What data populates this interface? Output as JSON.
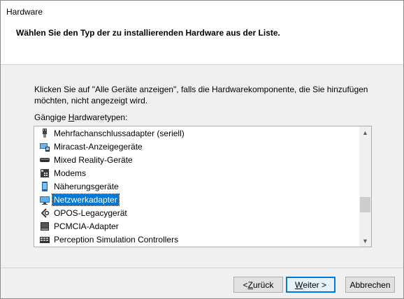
{
  "window": {
    "title": "Hardware",
    "subtitle": "Wählen Sie den Typ der zu installierenden Hardware aus der Liste."
  },
  "description": "Klicken Sie auf \"Alle Geräte anzeigen\", falls die Hardwarekomponente, die Sie hinzufügen möchten, nicht angezeigt wird.",
  "list": {
    "label_prefix": "Gängige ",
    "label_mnemonic": "H",
    "label_rest": "ardwaretypen:",
    "items": [
      {
        "label": "Mehrfachanschlussadapter (seriell)",
        "icon": "serial-port-icon"
      },
      {
        "label": "Miracast-Anzeigegeräte",
        "icon": "miracast-display-icon"
      },
      {
        "label": "Mixed Reality-Geräte",
        "icon": "headset-icon"
      },
      {
        "label": "Modems",
        "icon": "modem-icon"
      },
      {
        "label": "Näherungsgeräte",
        "icon": "proximity-device-icon"
      },
      {
        "label": "Netzwerkadapter",
        "icon": "network-adapter-icon",
        "selected": true
      },
      {
        "label": "OPOS-Legacygerät",
        "icon": "opos-device-icon"
      },
      {
        "label": "PCMCIA-Adapter",
        "icon": "pcmcia-icon"
      },
      {
        "label": "Perception Simulation Controllers",
        "icon": "perception-controller-icon"
      }
    ],
    "scroll_position": 0.72
  },
  "buttons": {
    "back_mnemonic": "Z",
    "back_prefix": "< ",
    "back_rest": "urück",
    "next_mnemonic": "W",
    "next_rest": "eiter >",
    "cancel": "Abbrechen"
  },
  "colors": {
    "selection": "#0078d7",
    "header_bg": "#ffffff",
    "dialog_bg": "#f0f0f0"
  }
}
